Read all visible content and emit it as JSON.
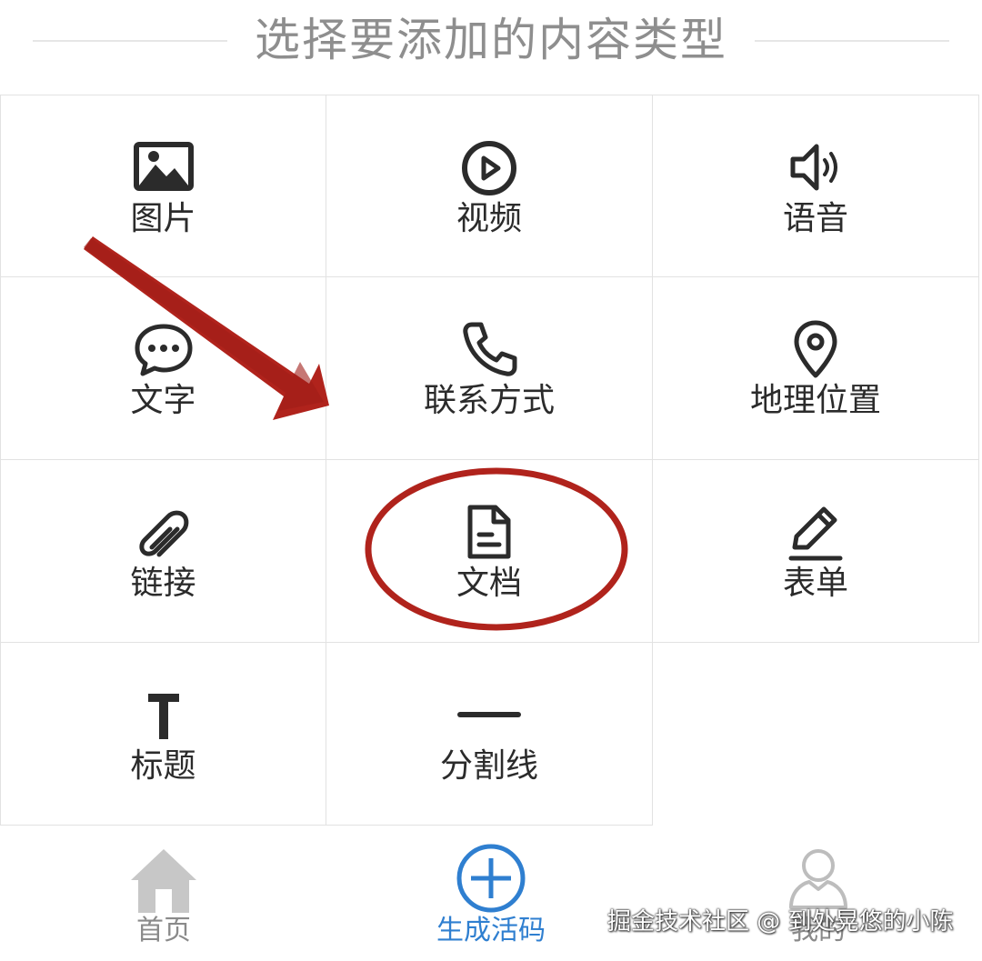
{
  "header": {
    "title": "选择要添加的内容类型"
  },
  "content_types": [
    {
      "label": "图片",
      "icon": "image-icon"
    },
    {
      "label": "视频",
      "icon": "video-play-icon"
    },
    {
      "label": "语音",
      "icon": "speaker-icon"
    },
    {
      "label": "文字",
      "icon": "chat-bubble-icon"
    },
    {
      "label": "联系方式",
      "icon": "phone-icon"
    },
    {
      "label": "地理位置",
      "icon": "location-pin-icon"
    },
    {
      "label": "链接",
      "icon": "paperclip-icon"
    },
    {
      "label": "文档",
      "icon": "document-icon"
    },
    {
      "label": "表单",
      "icon": "pencil-icon"
    },
    {
      "label": "标题",
      "icon": "text-t-icon"
    },
    {
      "label": "分割线",
      "icon": "divider-line-icon"
    }
  ],
  "tabbar": {
    "items": [
      {
        "label": "首页",
        "icon": "home-icon",
        "active": false
      },
      {
        "label": "生成活码",
        "icon": "add-circle-icon",
        "active": true
      },
      {
        "label": "我的",
        "icon": "user-icon",
        "active": false
      }
    ]
  },
  "watermark": {
    "text": "掘金技术社区 @ 到处晃悠的小陈"
  },
  "colors": {
    "active_tab": "#2f7fd0",
    "inactive_tab": "#8a8a8a",
    "icon_dark": "#2b2b2b",
    "annotation_red": "#b0231c",
    "title_gray": "#8e8e8e"
  }
}
